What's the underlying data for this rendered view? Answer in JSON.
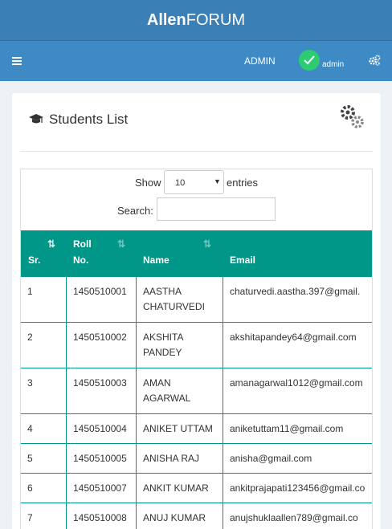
{
  "brand": {
    "bold": "Allen",
    "rest": "FORUM"
  },
  "nav": {
    "role": "ADMIN",
    "user": "admin"
  },
  "panel": {
    "title": "Students List"
  },
  "controls": {
    "show_label": "Show",
    "page_size": "10",
    "entries_label": "entries",
    "search_label": "Search:",
    "search_value": ""
  },
  "table": {
    "headers": {
      "sr": "Sr.",
      "roll_line1": "Roll",
      "roll_line2": "No.",
      "name": "Name",
      "email": "Email"
    },
    "rows": [
      {
        "sr": "1",
        "roll": "1450510001",
        "name": "AASTHA CHATURVEDI",
        "email": "chaturvedi.aastha.397@gmail."
      },
      {
        "sr": "2",
        "roll": "1450510002",
        "name": "AKSHITA PANDEY",
        "email": "akshitapandey64@gmail.com"
      },
      {
        "sr": "3",
        "roll": "1450510003",
        "name": "AMAN AGARWAL",
        "email": "amanagarwal1012@gmail.com"
      },
      {
        "sr": "4",
        "roll": "1450510004",
        "name": "ANIKET UTTAM",
        "email": "aniketuttam11@gmail.com"
      },
      {
        "sr": "5",
        "roll": "1450510005",
        "name": "ANISHA RAJ",
        "email": "anisha@gmail.com"
      },
      {
        "sr": "6",
        "roll": "1450510007",
        "name": "ANKIT KUMAR",
        "email": "ankitprajapati123456@gmail.co"
      },
      {
        "sr": "7",
        "roll": "1450510008",
        "name": "ANUJ KUMAR",
        "email": "anujshuklaallen789@gmail.co"
      }
    ]
  },
  "colors": {
    "brandbar": "#3a7fb5",
    "navbar": "#3e8ac4",
    "table_header": "#009688",
    "avatar": "#2ecc71"
  },
  "icons": {
    "menu": "hamburger-icon",
    "avatar": "check-icon",
    "settings": "cogs-icon",
    "title": "graduation-cap-icon",
    "panel_settings": "gears-icon"
  }
}
